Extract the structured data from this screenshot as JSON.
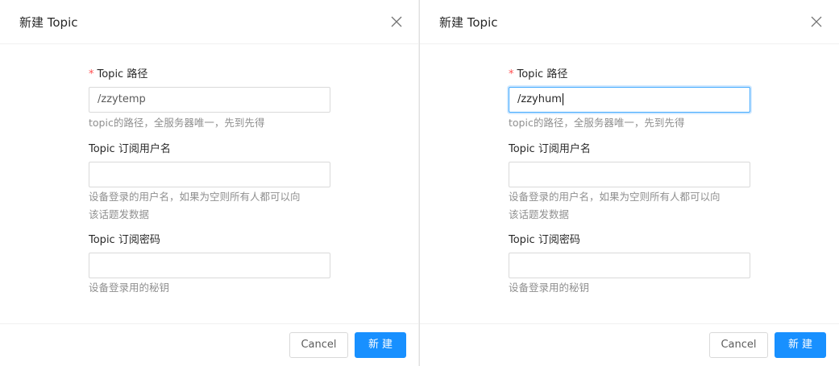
{
  "modals": [
    {
      "title": "新建 Topic",
      "fields": {
        "path": {
          "label": "Topic 路径",
          "required_mark": "*",
          "value": "/zzytemp",
          "help": "topic的路径，全服务器唯一，先到先得"
        },
        "username": {
          "label": "Topic 订阅用户名",
          "value": "",
          "help_line1": "设备登录的用户名，如果为空则所有人都可以向",
          "help_line2": "该话题发数据"
        },
        "password": {
          "label": "Topic 订阅密码",
          "value": "",
          "help": "设备登录用的秘钥"
        }
      },
      "footer": {
        "cancel_label": "Cancel",
        "ok_label": "新建"
      }
    },
    {
      "title": "新建 Topic",
      "fields": {
        "path": {
          "label": "Topic 路径",
          "required_mark": "*",
          "value": "/zzyhum",
          "help": "topic的路径，全服务器唯一，先到先得"
        },
        "username": {
          "label": "Topic 订阅用户名",
          "value": "",
          "help_line1": "设备登录的用户名，如果为空则所有人都可以向",
          "help_line2": "该话题发数据"
        },
        "password": {
          "label": "Topic 订阅密码",
          "value": "",
          "help": "设备登录用的秘钥"
        }
      },
      "footer": {
        "cancel_label": "Cancel",
        "ok_label": "新建"
      }
    }
  ],
  "icons": {
    "close": "close-icon"
  },
  "colors": {
    "primary": "#1890ff",
    "required": "#ff4d4f",
    "focus_border": "#40a9ff"
  }
}
